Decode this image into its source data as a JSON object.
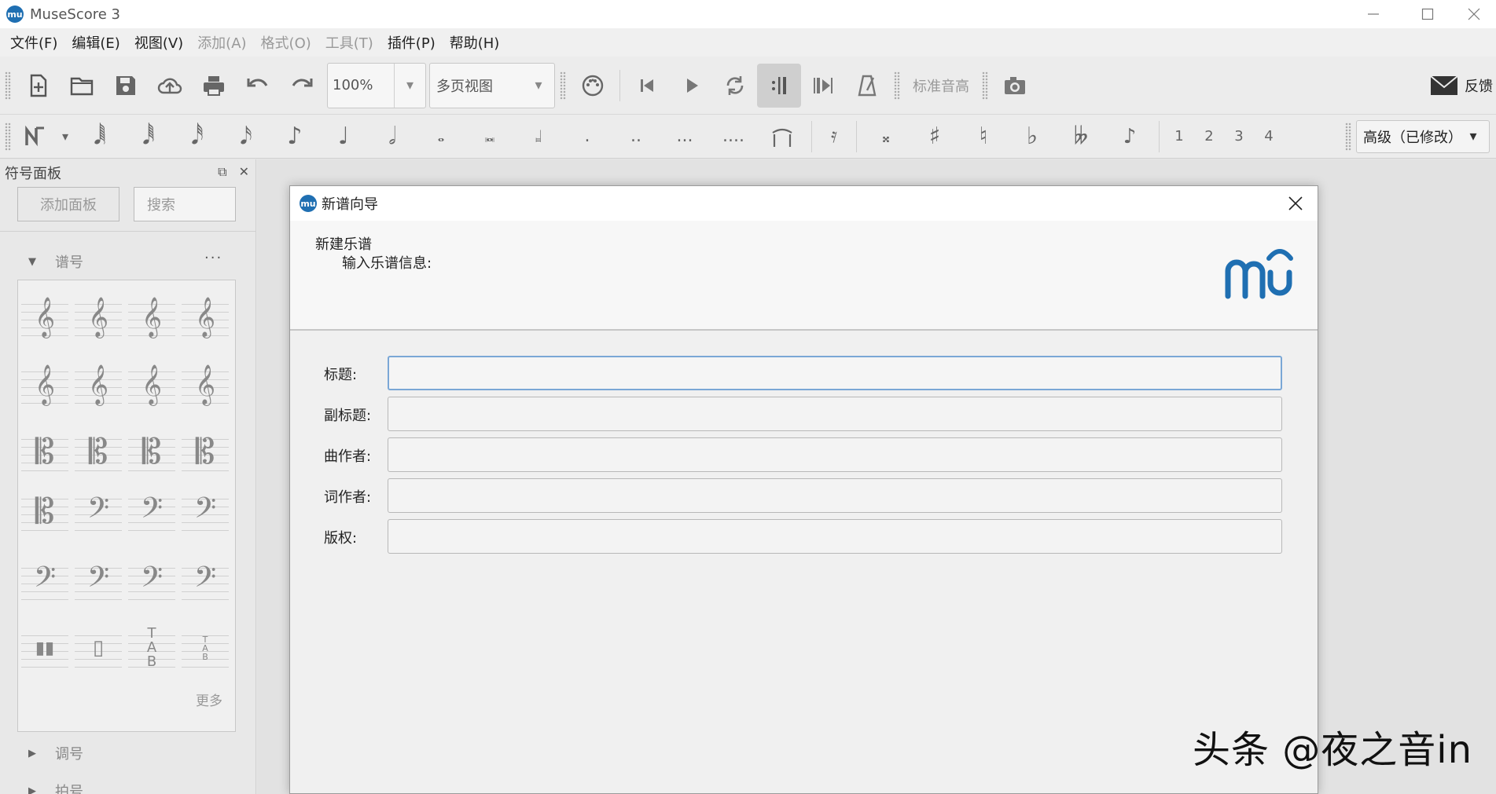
{
  "app": {
    "title": "MuseScore 3",
    "logo_text": "mu"
  },
  "menu": [
    {
      "label": "文件(F)",
      "enabled": true
    },
    {
      "label": "编辑(E)",
      "enabled": true
    },
    {
      "label": "视图(V)",
      "enabled": true
    },
    {
      "label": "添加(A)",
      "enabled": false
    },
    {
      "label": "格式(O)",
      "enabled": false
    },
    {
      "label": "工具(T)",
      "enabled": false
    },
    {
      "label": "插件(P)",
      "enabled": true
    },
    {
      "label": "帮助(H)",
      "enabled": true
    }
  ],
  "toolbar": {
    "zoom_value": "100%",
    "view_mode": "多页视图",
    "concert_pitch": "标准音高",
    "feedback": "反馈"
  },
  "note_toolbar": {
    "voices": [
      "1",
      "2",
      "3",
      "4"
    ],
    "workspace": "高级（已修改）"
  },
  "palette": {
    "title": "符号面板",
    "add_button": "添加面板",
    "search_placeholder": "搜索",
    "section_clefs": "谱号",
    "section_keys": "调号",
    "section_time": "拍号",
    "more": "更多",
    "section_menu": "···"
  },
  "dialog": {
    "title": "新谱向导",
    "heading": "新建乐谱",
    "subheading": "输入乐谱信息:",
    "fields": [
      {
        "label": "标题:",
        "value": ""
      },
      {
        "label": "副标题:",
        "value": ""
      },
      {
        "label": "曲作者:",
        "value": ""
      },
      {
        "label": "词作者:",
        "value": ""
      },
      {
        "label": "版权:",
        "value": ""
      }
    ]
  },
  "watermark": "头条 @夜之音in",
  "colors": {
    "accent": "#1f6fb2",
    "focus_border": "#7aa7d6"
  }
}
